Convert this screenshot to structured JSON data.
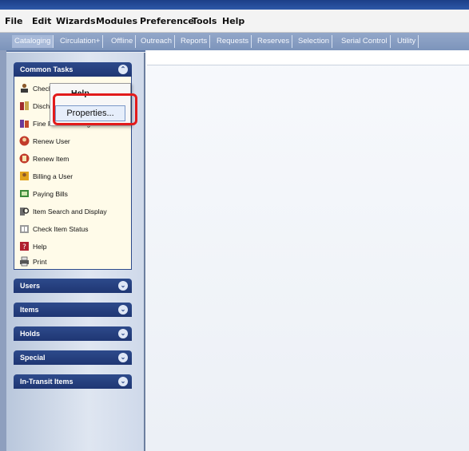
{
  "menubar": [
    "File",
    "Edit",
    "Wizards",
    "Modules",
    "Preference",
    "Tools",
    "Help"
  ],
  "tabs": [
    "Cataloging",
    "Circulation+",
    "Offline",
    "Outreach",
    "Reports",
    "Requests",
    "Reserves",
    "Selection",
    "Serial Control",
    "Utility"
  ],
  "common_tasks": {
    "title": "Common Tasks",
    "items": [
      "Checkout",
      "Discharge",
      "Fine Free Discharge",
      "Renew User",
      "Renew Item",
      "Billing a User",
      "Paying Bills",
      "Item Search and Display",
      "Check Item Status",
      "Help",
      "Print"
    ]
  },
  "context_menu": {
    "help": "Help",
    "properties": "Properties..."
  },
  "panels": [
    "Users",
    "Items",
    "Holds",
    "Special",
    "In-Transit Items"
  ],
  "colors": {
    "panel_header": "#2d4a8b",
    "tasks_bg": "#fffbe9",
    "highlight": "#e21b1b"
  }
}
